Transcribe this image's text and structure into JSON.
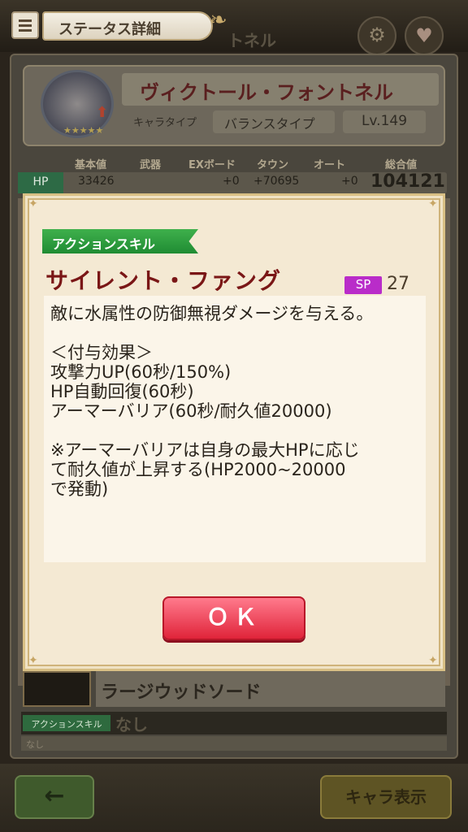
{
  "header": {
    "title": "ステータス詳細",
    "ghost_title": "トネル"
  },
  "character": {
    "name": "ヴィクトール・フォントネル",
    "type_label": "キャラタイプ",
    "type_value": "バランスタイプ",
    "level": "Lv.149",
    "stars": "★★★★★"
  },
  "stats": {
    "headers": [
      "基本値",
      "武器",
      "EXボード",
      "タウン",
      "オート",
      "総合値"
    ],
    "hp_label": "HP",
    "hp_values": [
      "33426",
      "",
      "+0",
      "+70695",
      "+0",
      "104121"
    ]
  },
  "dialog": {
    "tag": "アクションスキル",
    "skill_name": "サイレント・ファング",
    "sp_label": "SP",
    "sp_value": "27",
    "description_lines": [
      "敵に水属性の防御無視ダメージを与える。",
      "",
      "＜付与効果＞",
      "攻撃力UP(60秒/150%)",
      "HP自動回復(60秒)",
      "アーマーバリア(60秒/耐久値20000)",
      "",
      "※アーマーバリアは自身の最大HPに応じ",
      "て耐久値が上昇する(HP2000~20000",
      "で発動)"
    ],
    "ok_label": "ＯＫ"
  },
  "weapon": {
    "name": "ラージウッドソード",
    "skill_badge": "アクションスキル",
    "skill_value": "なし",
    "skill_sub": "なし"
  },
  "footer": {
    "back_icon": "←",
    "chara_button": "キャラ表示"
  }
}
